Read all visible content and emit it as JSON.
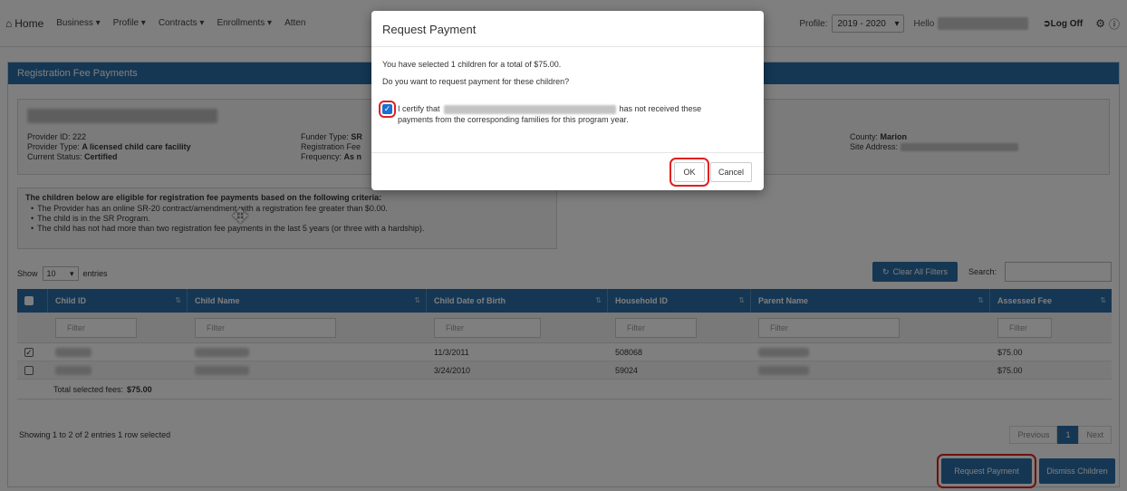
{
  "nav": {
    "home": "Home",
    "items": [
      "Business",
      "Profile",
      "Contracts",
      "Enrollments",
      "Atten"
    ],
    "profile_label": "Profile:",
    "profile_value": "2019 - 2020",
    "hello": "Hello",
    "logoff": "Log Off"
  },
  "panel": {
    "title": "Registration Fee Payments"
  },
  "provider": {
    "id_label": "Provider ID:",
    "id_value": "222",
    "type_label": "Provider Type:",
    "type_value": "A licensed child care facility",
    "status_label": "Current Status:",
    "status_value": "Certified",
    "funder_label": "Funder Type:",
    "funder_value": "SR",
    "regfee_label": "Registration Fee",
    "freq_label": "Frequency:",
    "freq_value": "As n",
    "county_label": "County:",
    "county_value": "Marion",
    "site_label": "Site Address:"
  },
  "criteria": {
    "heading": "The children below are eligible for registration fee payments based on the following criteria:",
    "items": [
      "The Provider has an online SR-20 contract/amendment with a registration fee greater than $0.00.",
      "The child is in the SR Program.",
      "The child has not had more than two registration fee payments in the last 5 years (or three with a hardship)."
    ]
  },
  "controls": {
    "show": "Show",
    "entries_value": "10",
    "entries": "entries",
    "clear_filters": "Clear All Filters",
    "search": "Search:"
  },
  "table": {
    "columns": [
      "Child ID",
      "Child Name",
      "Child Date of Birth",
      "Household ID",
      "Parent Name",
      "Assessed Fee"
    ],
    "filter_placeholder": "Filter",
    "rows": [
      {
        "dob": "11/3/2011",
        "household": "508068",
        "fee": "$75.00",
        "checked": true
      },
      {
        "dob": "3/24/2010",
        "household": "59024",
        "fee": "$75.00",
        "checked": false
      }
    ],
    "total_label": "Total selected fees:",
    "total_value": "$75.00"
  },
  "footer": {
    "showing": "Showing 1 to 2 of 2 entries   1 row selected",
    "previous": "Previous",
    "page": "1",
    "next": "Next",
    "request_payment": "Request Payment",
    "dismiss": "Dismiss Children"
  },
  "modal": {
    "title": "Request Payment",
    "line1": "You have selected 1 children for a total of $75.00.",
    "line2": "Do you want to request payment for these children?",
    "certify_a": "I certify that",
    "certify_b": "has not received these",
    "certify_c": "payments from the corresponding families for this program year.",
    "ok": "OK",
    "cancel": "Cancel"
  }
}
